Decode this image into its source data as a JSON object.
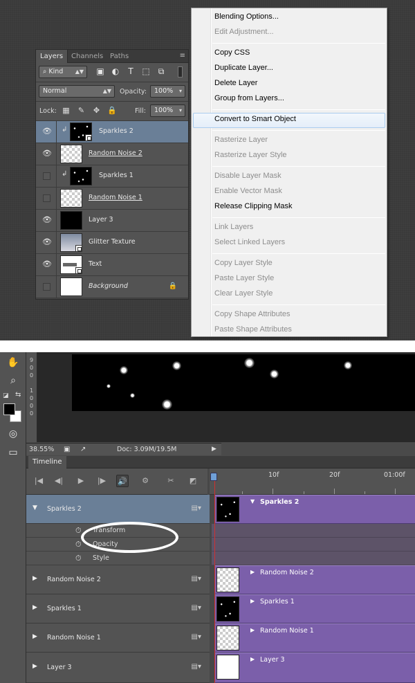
{
  "layers_panel": {
    "tabs": [
      "Layers",
      "Channels",
      "Paths"
    ],
    "filter_kind": "Kind",
    "blend_mode": "Normal",
    "opacity_label": "Opacity:",
    "opacity_value": "100%",
    "lock_label": "Lock:",
    "fill_label": "Fill:",
    "fill_value": "100%",
    "layers": [
      {
        "name": "Sparkles 2",
        "visible": true,
        "selected": true,
        "clipped": true,
        "thumb": "stars-smart"
      },
      {
        "name": "Random Noise 2",
        "visible": true,
        "selected": false,
        "clipped": false,
        "thumb": "checker"
      },
      {
        "name": "Sparkles 1",
        "visible": false,
        "selected": false,
        "clipped": true,
        "thumb": "stars"
      },
      {
        "name": "Random Noise 1",
        "visible": false,
        "selected": false,
        "clipped": false,
        "thumb": "checker"
      },
      {
        "name": "Layer 3",
        "visible": true,
        "selected": false,
        "clipped": false,
        "thumb": "black"
      },
      {
        "name": "Glitter Texture",
        "visible": true,
        "selected": false,
        "clipped": false,
        "thumb": "glitter-smart"
      },
      {
        "name": "Text",
        "visible": true,
        "selected": false,
        "clipped": false,
        "thumb": "text-smart"
      },
      {
        "name": "Background",
        "visible": false,
        "selected": false,
        "clipped": false,
        "thumb": "white"
      }
    ]
  },
  "context_menu": {
    "items": [
      {
        "label": "Blending Options...",
        "enabled": true
      },
      {
        "label": "Edit Adjustment...",
        "enabled": false
      },
      {
        "label": "Copy CSS",
        "enabled": true
      },
      {
        "label": "Duplicate Layer...",
        "enabled": true
      },
      {
        "label": "Delete Layer",
        "enabled": true
      },
      {
        "label": "Group from Layers...",
        "enabled": true
      },
      {
        "label": "Convert to Smart Object",
        "enabled": true,
        "highlighted": true
      },
      {
        "label": "Rasterize Layer",
        "enabled": false
      },
      {
        "label": "Rasterize Layer Style",
        "enabled": false
      },
      {
        "label": "Disable Layer Mask",
        "enabled": false
      },
      {
        "label": "Enable Vector Mask",
        "enabled": false
      },
      {
        "label": "Release Clipping Mask",
        "enabled": true
      },
      {
        "label": "Link Layers",
        "enabled": false
      },
      {
        "label": "Select Linked Layers",
        "enabled": false
      },
      {
        "label": "Copy Layer Style",
        "enabled": false
      },
      {
        "label": "Paste Layer Style",
        "enabled": false
      },
      {
        "label": "Clear Layer Style",
        "enabled": false
      },
      {
        "label": "Copy Shape Attributes",
        "enabled": false
      },
      {
        "label": "Paste Shape Attributes",
        "enabled": false
      }
    ]
  },
  "ruler_digits": [
    "9",
    "0",
    "0",
    "1",
    "0",
    "0",
    "0"
  ],
  "status_bar": {
    "zoom": "38.55%",
    "doc": "Doc: 3.09M/19.5M"
  },
  "timeline": {
    "tab": "Timeline",
    "ruler_labels": [
      "10f",
      "20f",
      "01:00f"
    ],
    "tracks": [
      {
        "name": "Sparkles 2",
        "expanded": true,
        "selected": true,
        "clip": "Sparkles 2",
        "clip_thumb": "stars"
      },
      {
        "name": "Random Noise 2",
        "expanded": false,
        "selected": false,
        "clip": "Random Noise 2",
        "clip_thumb": "checker"
      },
      {
        "name": "Sparkles 1",
        "expanded": false,
        "selected": false,
        "clip": "Sparkles 1",
        "clip_thumb": "stars"
      },
      {
        "name": "Random Noise 1",
        "expanded": false,
        "selected": false,
        "clip": "Random Noise 1",
        "clip_thumb": "checker"
      },
      {
        "name": "Layer 3",
        "expanded": false,
        "selected": false,
        "clip": "Layer 3",
        "clip_thumb": "white"
      }
    ],
    "properties": [
      "Transform",
      "Opacity",
      "Style"
    ]
  },
  "colors": {
    "selection": "#6a7f97",
    "clip": "#7b5faa",
    "playhead": "#d03030"
  }
}
